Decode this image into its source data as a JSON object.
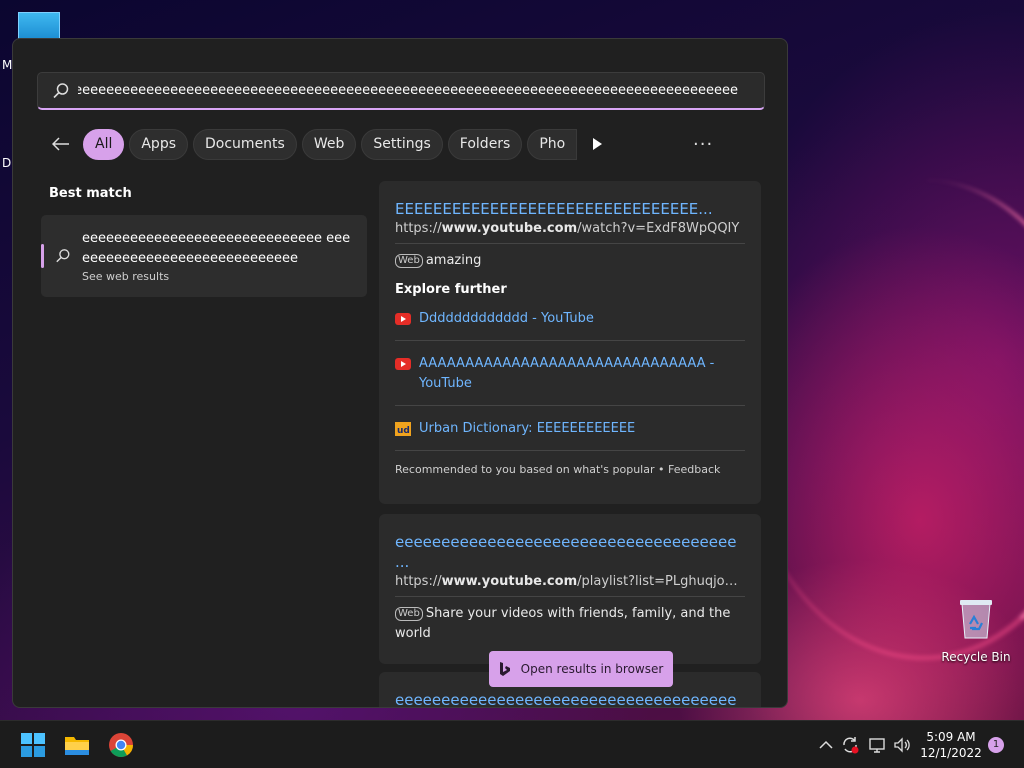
{
  "desktop": {
    "recycle_bin_label": "Recycle Bin",
    "left_fragments": [
      "M",
      "Da"
    ]
  },
  "search": {
    "query": "eeeeeeeeeeeeeeeeeeeeeeeeeeeeeeeeeeeeeeeeeeeeeeeeeeeeeeeeeeeeeeeeeeeeeeeeeeeeeeeeeeeeeeeeeeeeeeeeeeeeeeeeeeeeeeeeeeeeeeeeeeee",
    "filters": [
      "All",
      "Apps",
      "Documents",
      "Web",
      "Settings",
      "Folders",
      "Pho"
    ],
    "active_filter": "All",
    "more_label": "···"
  },
  "best_match": {
    "heading": "Best match",
    "text": "eeeeeeeeeeeeeeeeeeeeeeeeeeeeee eeeeeeeeeeeeeeeeeeeeeeeeeeeeee",
    "subtitle": "See web results"
  },
  "results": [
    {
      "title": "EEEEEEEEEEEEEEEEEEEEEEEEEEEEEEEE...",
      "url_prefix": "https://",
      "url_domain": "www.youtube.com",
      "url_path": "/watch?v=ExdF8WpQQIY",
      "web_tag": "Web",
      "snippet": "amazing",
      "explore_heading": "Explore further",
      "explore": [
        {
          "icon": "youtube-icon",
          "label": "Ddddddddddddd - YouTube"
        },
        {
          "icon": "youtube-icon",
          "label": "AAAAAAAAAAAAAAAAAAAAAAAAAAAAAAA - YouTube"
        },
        {
          "icon": "urban-dictionary-icon",
          "label": "Urban Dictionary: EEEEEEEEEEEE"
        }
      ],
      "recommendation": "Recommended to you based on what's popular • Feedback"
    },
    {
      "title": "eeeeeeeeeeeeeeeeeeeeeeeeeeeeeeeeeeeee ...",
      "url_prefix": "https://",
      "url_domain": "www.youtube.com",
      "url_path": "/playlist?list=PLghuqjoGkb...",
      "web_tag": "Web",
      "snippet": "Share your videos with friends, family, and the world"
    },
    {
      "title": "eeeeeeeeeeeeeeeeeeeeeeeeeeeeeeeeeeeee"
    }
  ],
  "open_in_browser": "Open results in browser",
  "taskbar": {
    "time": "5:09 AM",
    "date": "12/1/2022",
    "notification_count": "1"
  },
  "colors": {
    "accent": "#d7a1ea",
    "link": "#6fb6ff",
    "panel_bg": "#202020"
  }
}
